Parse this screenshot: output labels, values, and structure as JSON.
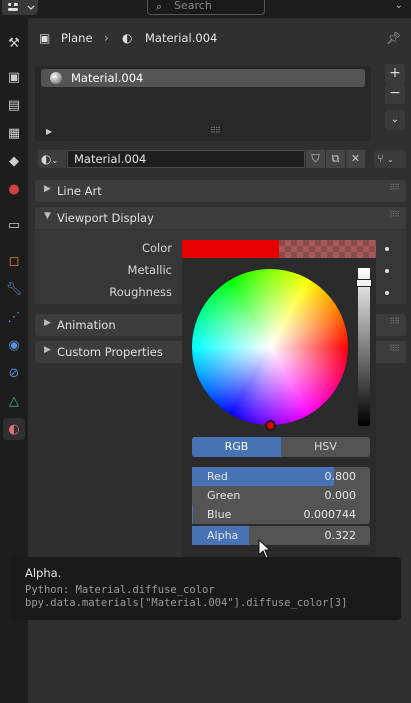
{
  "header": {
    "search_placeholder": "Search"
  },
  "breadcrumb": {
    "object": "Plane",
    "material": "Material.004"
  },
  "slots": {
    "items": [
      {
        "label": "Material.004",
        "selected": true
      }
    ]
  },
  "material_selector": {
    "name": "Material.004"
  },
  "panels": {
    "line_art": "Line Art",
    "viewport_display": "Viewport Display",
    "animation": "Animation",
    "custom_properties": "Custom Properties"
  },
  "viewport_props": {
    "color_label": "Color",
    "metallic_label": "Metallic",
    "roughness_label": "Roughness"
  },
  "color_picker": {
    "swatch_color": "#e60000",
    "modes": [
      "RGB",
      "HSV"
    ],
    "active_mode": "RGB",
    "fields": {
      "red": {
        "label": "Red",
        "value": "0.800"
      },
      "green": {
        "label": "Green",
        "value": "0.000"
      },
      "blue": {
        "label": "Blue",
        "value": "0.000744"
      },
      "alpha": {
        "label": "Alpha",
        "value": "0.322"
      }
    }
  },
  "tooltip": {
    "title": "Alpha.",
    "python_line": "Python: Material.diffuse_color",
    "path_line": "bpy.data.materials[\"Material.004\"].diffuse_color[3]"
  },
  "colors": {
    "accent": "#4772b3",
    "background": "#303030"
  },
  "icons": [
    "editor-type-icon",
    "search-icon",
    "tool-icon",
    "render-icon",
    "output-icon",
    "view-layer-icon",
    "scene-icon",
    "world-icon",
    "collection-icon",
    "object-icon",
    "modifier-icon",
    "particles-icon",
    "physics-icon",
    "constraints-icon",
    "data-icon",
    "material-icon",
    "pin-icon"
  ]
}
